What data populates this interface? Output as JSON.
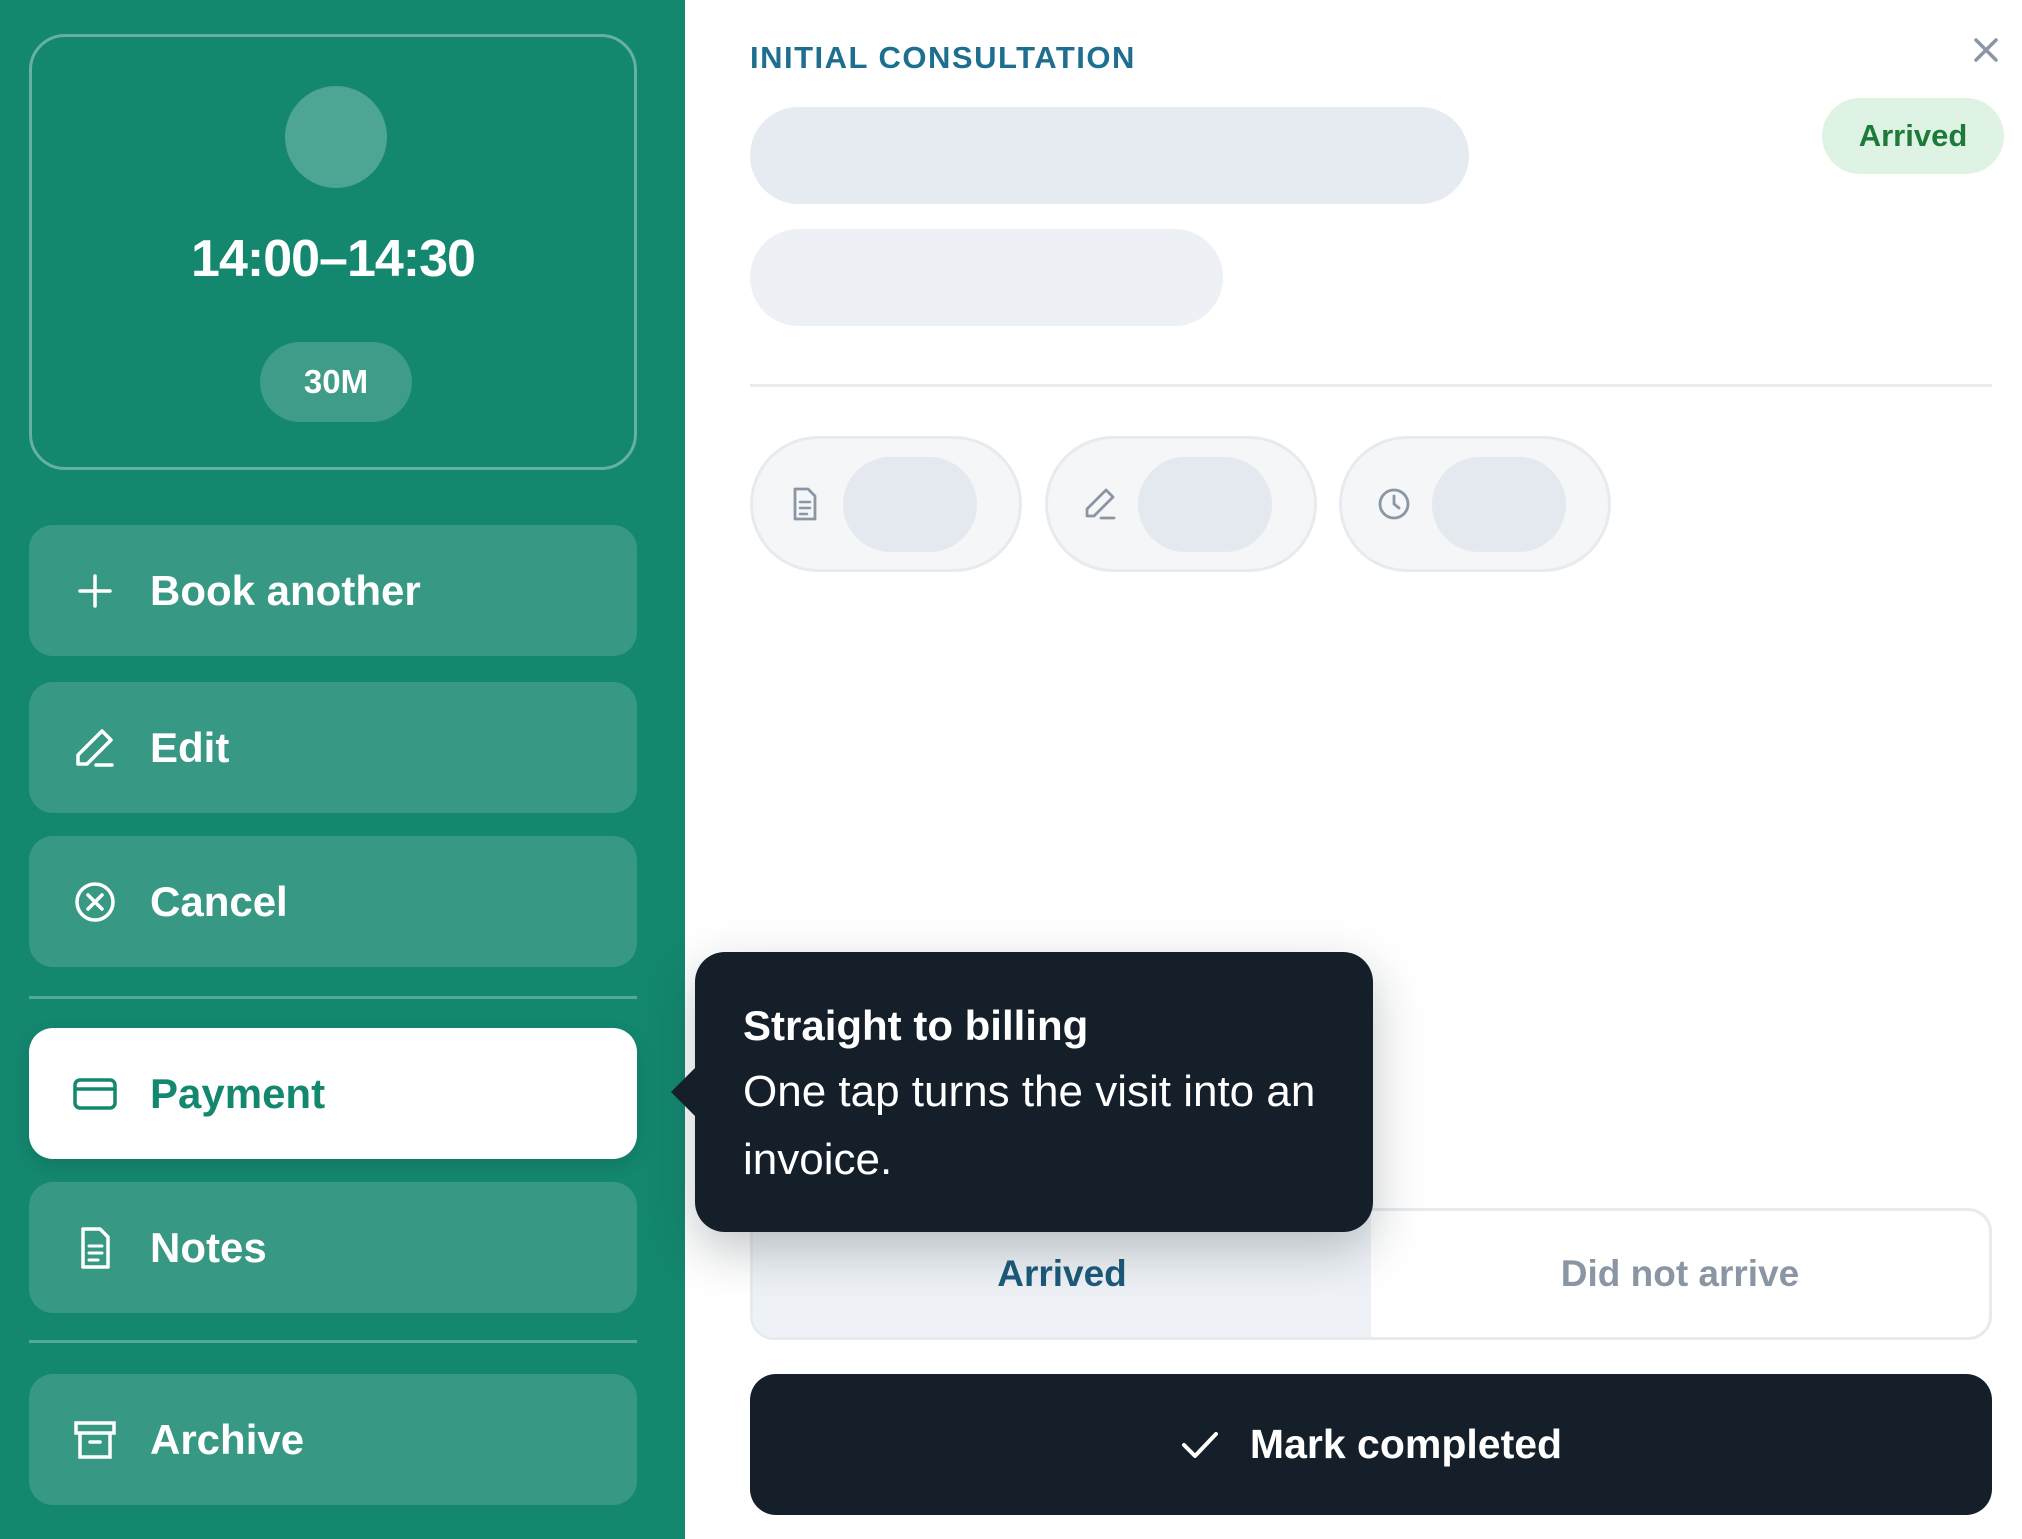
{
  "appointment": {
    "time_range": "14:00–14:30",
    "duration": "30M"
  },
  "actions": {
    "book_another": "Book another",
    "edit": "Edit",
    "cancel": "Cancel",
    "payment": "Payment",
    "notes": "Notes",
    "archive": "Archive"
  },
  "detail": {
    "kicker": "INITIAL CONSULTATION",
    "status": "Arrived",
    "chips": [
      "document-icon",
      "pencil-icon",
      "clock-icon"
    ]
  },
  "attendance": {
    "arrived": "Arrived",
    "did_not_arrive": "Did not arrive",
    "selected": "Arrived"
  },
  "primary_action": "Mark completed",
  "tooltip": {
    "title": "Straight to billing",
    "body": "One tap turns the visit into an invoice."
  },
  "colors": {
    "brand_green": "#14876f",
    "dark": "#141f29",
    "kicker_blue": "#1e6f8f",
    "arrived_bg": "#dff3e4",
    "arrived_text": "#1d7a3a"
  }
}
